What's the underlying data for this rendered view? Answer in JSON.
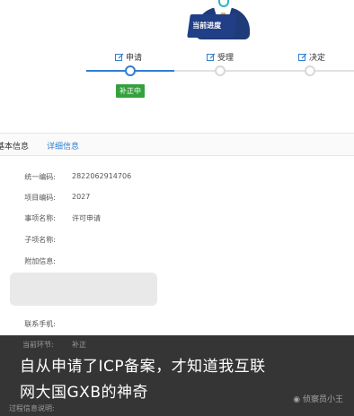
{
  "illustration": {
    "banner_text": "当前进度"
  },
  "progress": {
    "steps": [
      {
        "label": "申请"
      },
      {
        "label": "受理"
      },
      {
        "label": "决定"
      }
    ],
    "current_status": "补正中",
    "accent": "#2f7fd3",
    "status_color": "#33a13c"
  },
  "tabs": [
    {
      "label": "基本信息"
    },
    {
      "label": "详细信息"
    }
  ],
  "info": {
    "rows": [
      {
        "label": "统一编码:",
        "value": "2822062914706"
      },
      {
        "label": "项目编码:",
        "value": "2027"
      },
      {
        "label": "事项名称:",
        "value": "许可申请"
      },
      {
        "label": "子项名称:",
        "value": ""
      },
      {
        "label": "附加信息:",
        "value": ""
      }
    ],
    "phone_label": "联系手机:",
    "current_status_label": "当前环节:",
    "current_status_value": "补正",
    "process_label": "过程信息说明:"
  },
  "overlay": {
    "line1": "自从申请了ICP备案，才知道我互联",
    "line2": "网大国GXB的神奇",
    "watermark": "侦察员小王"
  }
}
